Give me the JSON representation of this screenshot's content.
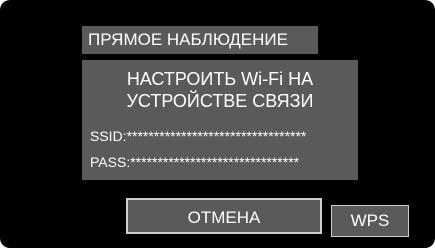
{
  "header": {
    "title": "ПРЯМОЕ НАБЛЮДЕНИЕ"
  },
  "dialog": {
    "message_line1": "НАСТРОИТЬ Wi-Fi НА",
    "message_line2": "УСТРОЙСТВЕ СВЯЗИ",
    "ssid_text": "SSID:*********************************",
    "pass_text": "PASS:*******************************"
  },
  "buttons": {
    "cancel_label": "ОТМЕНА",
    "wps_label": "WPS"
  },
  "colors": {
    "screen_background": "#000000",
    "panel_gray": "#5a5a5a",
    "text": "#ffffff"
  }
}
